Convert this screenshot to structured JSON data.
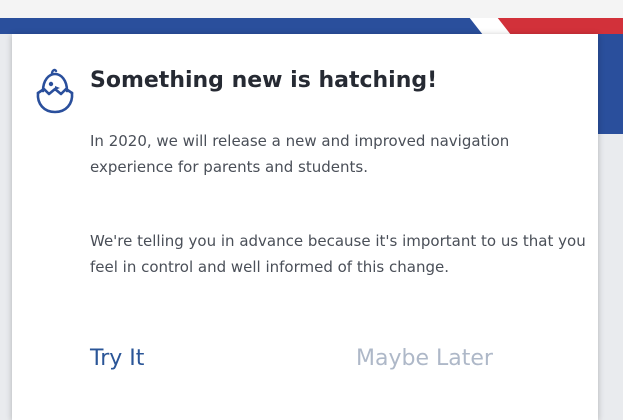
{
  "modal": {
    "title": "Something new is hatching!",
    "paragraph_1": "In 2020, we will release a new and improved navigation experience for parents and students.",
    "paragraph_2": "We're telling you in advance because it's important to us that you feel in control and well informed of this change.",
    "primary_button": "Try It",
    "secondary_button": "Maybe Later",
    "icon": "hatching-chick-icon"
  },
  "colors": {
    "brand_blue": "#2a4f9c",
    "brand_red": "#d2313a",
    "title_text": "#262a33",
    "body_text": "#4a4f58",
    "primary_button": "#2a5597",
    "secondary_button": "#aeb8c8"
  }
}
